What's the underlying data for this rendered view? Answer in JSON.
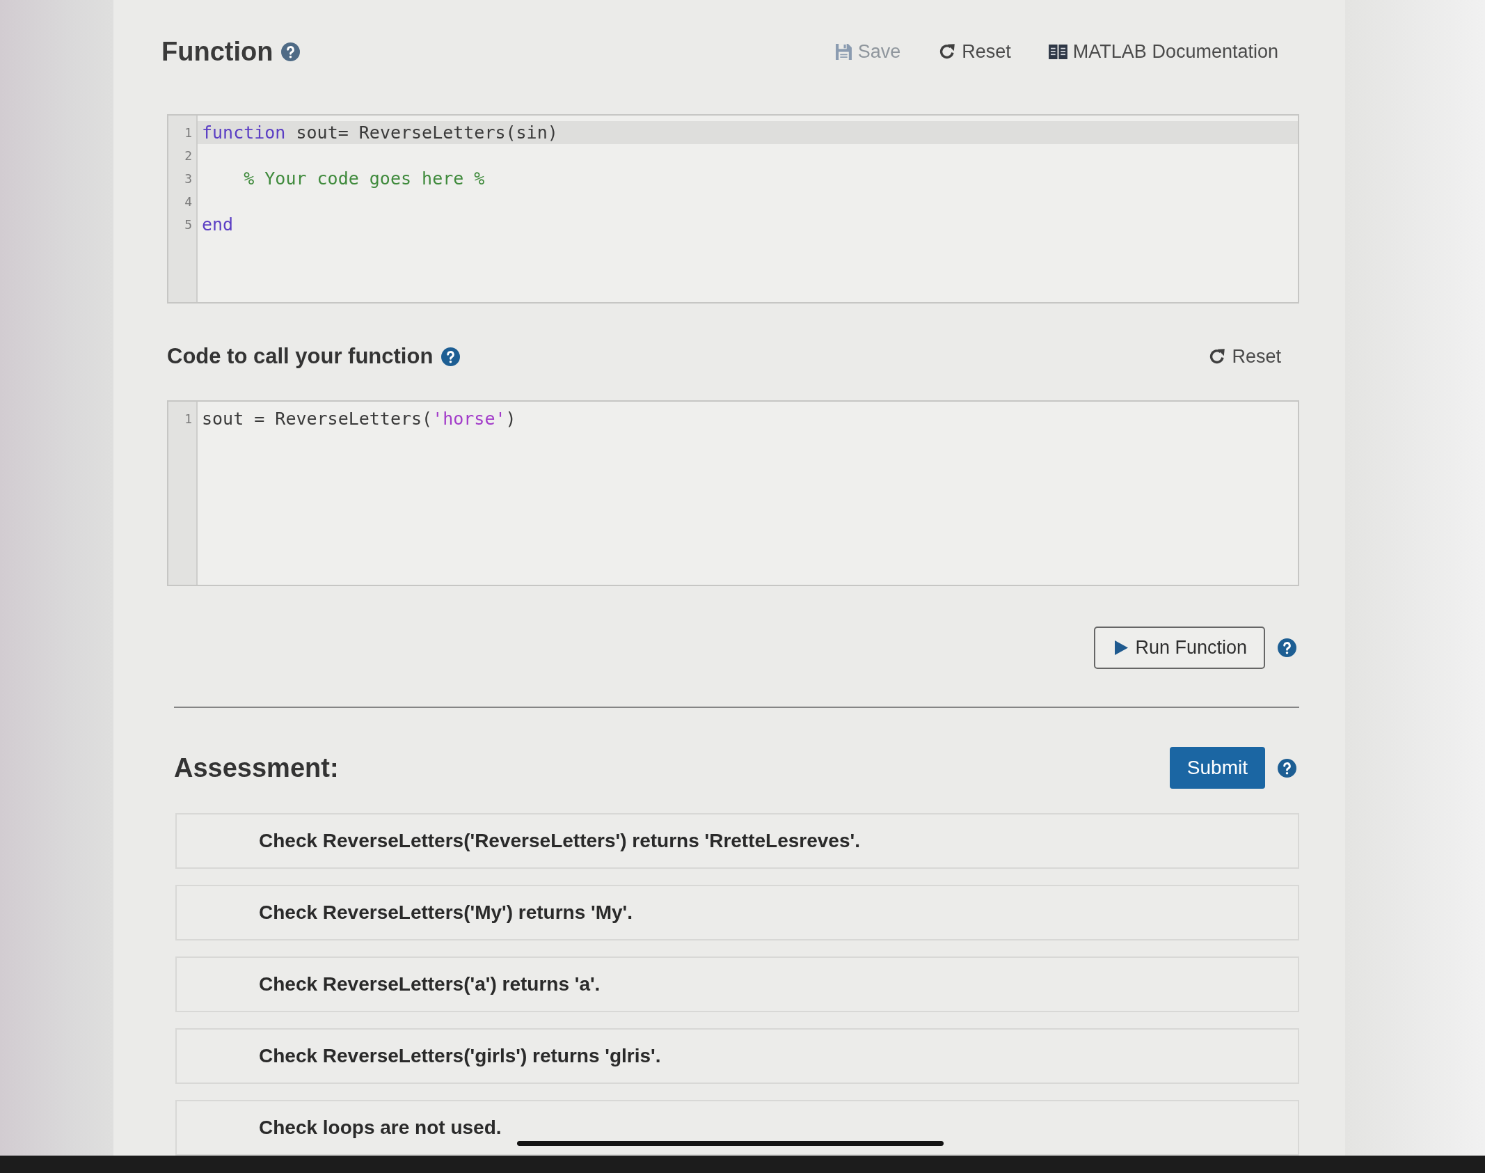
{
  "function_panel": {
    "title": "Function",
    "toolbar": [
      {
        "kind": "save",
        "label": "Save",
        "disabled": true
      },
      {
        "kind": "reset",
        "label": "Reset",
        "disabled": false
      },
      {
        "kind": "docs",
        "label": "MATLAB Documentation",
        "disabled": false
      }
    ],
    "editor": {
      "lines": [
        {
          "number": "1",
          "highlighted": true,
          "tokens": [
            {
              "kind": "keyword",
              "text": "function"
            },
            {
              "kind": "plain",
              "text": " sout= ReverseLetters(sin)"
            }
          ]
        },
        {
          "number": "2",
          "highlighted": false
        },
        {
          "number": "3",
          "highlighted": false,
          "tokens": [
            {
              "kind": "comment",
              "text": "    % Your code goes here %"
            }
          ]
        },
        {
          "number": "4",
          "highlighted": false
        },
        {
          "number": "5",
          "highlighted": false,
          "tokens": [
            {
              "kind": "keyword",
              "text": "end"
            }
          ]
        }
      ]
    }
  },
  "call_panel": {
    "title": "Code to call your function",
    "toolbar": [
      {
        "kind": "reset",
        "label": "Reset",
        "disabled": false
      }
    ],
    "editor": {
      "lines": [
        {
          "number": "1",
          "highlighted": false,
          "tokens": [
            {
              "kind": "plain",
              "text": "sout = ReverseLetters("
            },
            {
              "kind": "string",
              "text": "'horse'"
            },
            {
              "kind": "plain",
              "text": ")"
            }
          ]
        }
      ]
    },
    "run_button": "Run Function"
  },
  "assessment": {
    "title": "Assessment:",
    "submit_button": "Submit",
    "checks": [
      "Check ReverseLetters('ReverseLetters') returns 'RretteLesreves'.",
      "Check ReverseLetters('My') returns 'My'.",
      "Check ReverseLetters('a') returns 'a'.",
      "Check ReverseLetters('girls') returns 'glris'.",
      "Check loops are not used."
    ]
  }
}
